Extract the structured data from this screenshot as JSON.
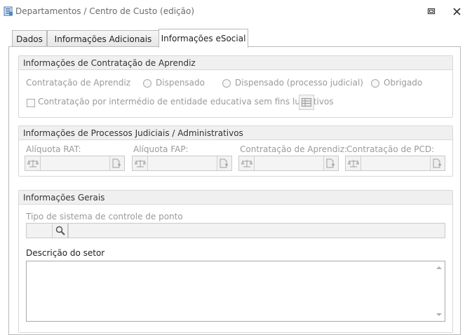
{
  "window": {
    "title": "Departamentos / Centro de Custo (edição)",
    "icons": {
      "app": "form-icon",
      "restore": "restore-icon",
      "close": "close-icon"
    }
  },
  "tabs": [
    {
      "label": "Dados",
      "active": false
    },
    {
      "label": "Informações Adicionais",
      "active": false
    },
    {
      "label": "Informações eSocial",
      "active": true
    }
  ],
  "aprendiz": {
    "header": "Informações de Contratação de Aprendiz",
    "label": "Contratação de Aprendiz",
    "options": [
      "Dispensado",
      "Dispensado (processo judicial)",
      "Obrigado"
    ],
    "checkbox_label": "Contratação por intermédio de entidade educativa sem fins lucrativos",
    "checkbox_checked": false
  },
  "processos": {
    "header": "Informações de Processos Judiciais / Administrativos",
    "fields": [
      {
        "label": "Alíquota RAT:",
        "value": ""
      },
      {
        "label": "Alíquota FAP:",
        "value": ""
      },
      {
        "label": "Contratação de Aprendiz:",
        "value": ""
      },
      {
        "label": "Contratação de PCD:",
        "value": ""
      }
    ]
  },
  "gerais": {
    "header": "Informações Gerais",
    "ponto_label": "Tipo de sistema de controle de ponto",
    "ponto_code": "",
    "ponto_desc": "",
    "descricao_label": "Descrição do setor",
    "descricao_value": ""
  },
  "colors": {
    "border": "#b9b9b9",
    "group_header_bg": "#f0f0f0",
    "disabled_text": "#9a9a9a"
  }
}
